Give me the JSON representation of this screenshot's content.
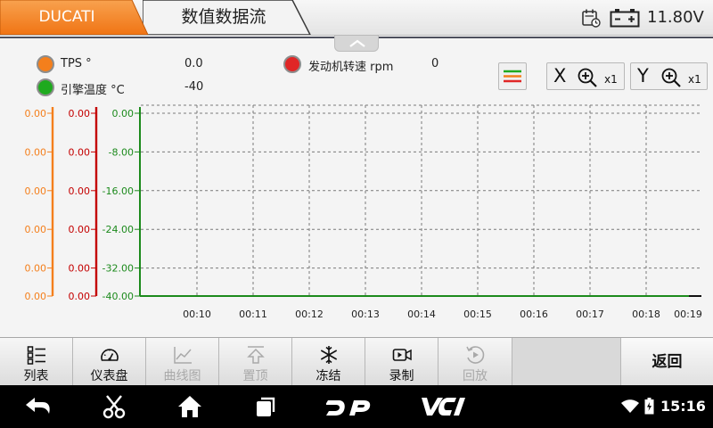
{
  "header": {
    "brand": "DUCATI",
    "title": "数值数据流",
    "voltage": "11.80V",
    "colors": {
      "brand_tab": "#f47f1c",
      "title_tab": "#f2f2f2"
    },
    "icons": [
      "calendar-icon",
      "battery-icon"
    ]
  },
  "legend": [
    {
      "label": "TPS °",
      "value": "0.0",
      "color": "#f47f1c"
    },
    {
      "label": "引擎温度 °C",
      "value": "-40",
      "color": "#1faa1f"
    },
    {
      "label": "发动机转速 rpm",
      "value": "0",
      "color": "#e02626"
    }
  ],
  "controls": {
    "x_zoom": {
      "axis": "X",
      "factor": "x1"
    },
    "y_zoom": {
      "axis": "Y",
      "factor": "x1"
    },
    "icons": [
      "series-toggle-icon",
      "zoom-in-icon",
      "collapse-chevron-icon"
    ]
  },
  "chart_data": {
    "type": "line",
    "series": [
      {
        "name": "TPS °",
        "color": "#f47f1c",
        "x": [],
        "y": []
      },
      {
        "name": "发动机转速 rpm",
        "color": "#e02626",
        "x": [],
        "y": []
      },
      {
        "name": "引擎温度 °C",
        "color": "#1faa1f",
        "x": [],
        "y": []
      }
    ],
    "x_ticks": [
      "00:10",
      "00:11",
      "00:12",
      "00:13",
      "00:14",
      "00:15",
      "00:16",
      "00:17",
      "00:18",
      "00:19"
    ],
    "y_axes": [
      {
        "series": "TPS °",
        "color": "#f47f1c",
        "ticks": [
          "0.00",
          "0.00",
          "0.00",
          "0.00",
          "0.00",
          "0.00"
        ]
      },
      {
        "series": "发动机转速 rpm",
        "color": "#c40000",
        "ticks": [
          "0.00",
          "0.00",
          "0.00",
          "0.00",
          "0.00",
          "0.00"
        ]
      },
      {
        "series": "引擎温度 °C",
        "color": "#1c8a1c",
        "ticks": [
          "0.00",
          "-8.00",
          "-16.00",
          "-24.00",
          "-32.00",
          "-40.00"
        ]
      }
    ],
    "ylim": [
      -40,
      0
    ],
    "grid": true,
    "legend_placement": "top-left"
  },
  "toolbar": {
    "buttons": [
      {
        "label": "列表",
        "icon": "list-icon",
        "enabled": true
      },
      {
        "label": "仪表盘",
        "icon": "gauge-icon",
        "enabled": true
      },
      {
        "label": "曲线图",
        "icon": "line-chart-icon",
        "enabled": false
      },
      {
        "label": "置顶",
        "icon": "pin-top-icon",
        "enabled": false
      },
      {
        "label": "冻结",
        "icon": "snowflake-icon",
        "enabled": true
      },
      {
        "label": "录制",
        "icon": "video-record-icon",
        "enabled": true
      },
      {
        "label": "回放",
        "icon": "playback-icon",
        "enabled": false
      }
    ],
    "back_label": "返回"
  },
  "system_bar": {
    "time": "15:16",
    "icons": [
      "back-arrow-icon",
      "scissors-icon",
      "home-icon",
      "recent-apps-icon",
      "dp-logo-icon",
      "vci-logo-icon",
      "wifi-icon",
      "battery-status-icon"
    ]
  }
}
